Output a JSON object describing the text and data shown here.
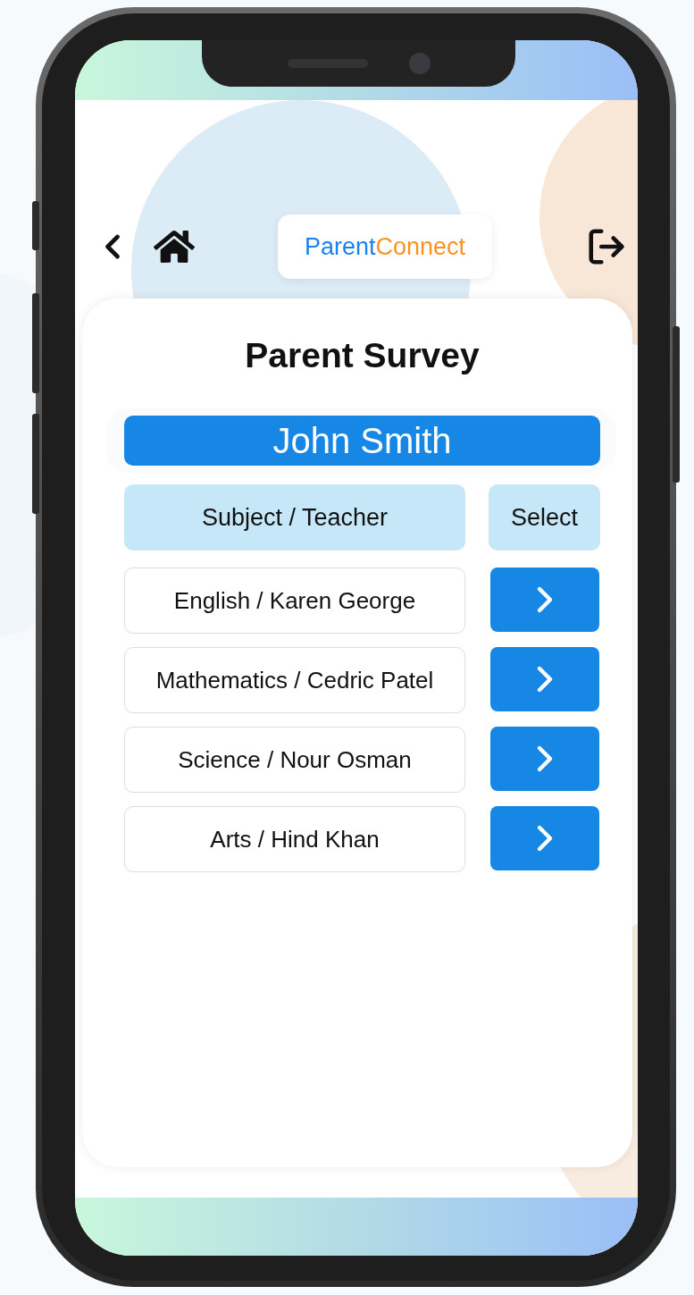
{
  "header": {
    "brand": {
      "part_1": "Parent",
      "part_2": "Connect"
    }
  },
  "survey": {
    "title": "Parent Survey",
    "student": "John Smith",
    "columns": [
      "Subject / Teacher",
      "Select"
    ],
    "rows": [
      {
        "label": "English / Karen George"
      },
      {
        "label": "Mathematics / Cedric Patel"
      },
      {
        "label": "Science / Nour Osman"
      },
      {
        "label": "Arts / Hind Khan"
      }
    ]
  }
}
